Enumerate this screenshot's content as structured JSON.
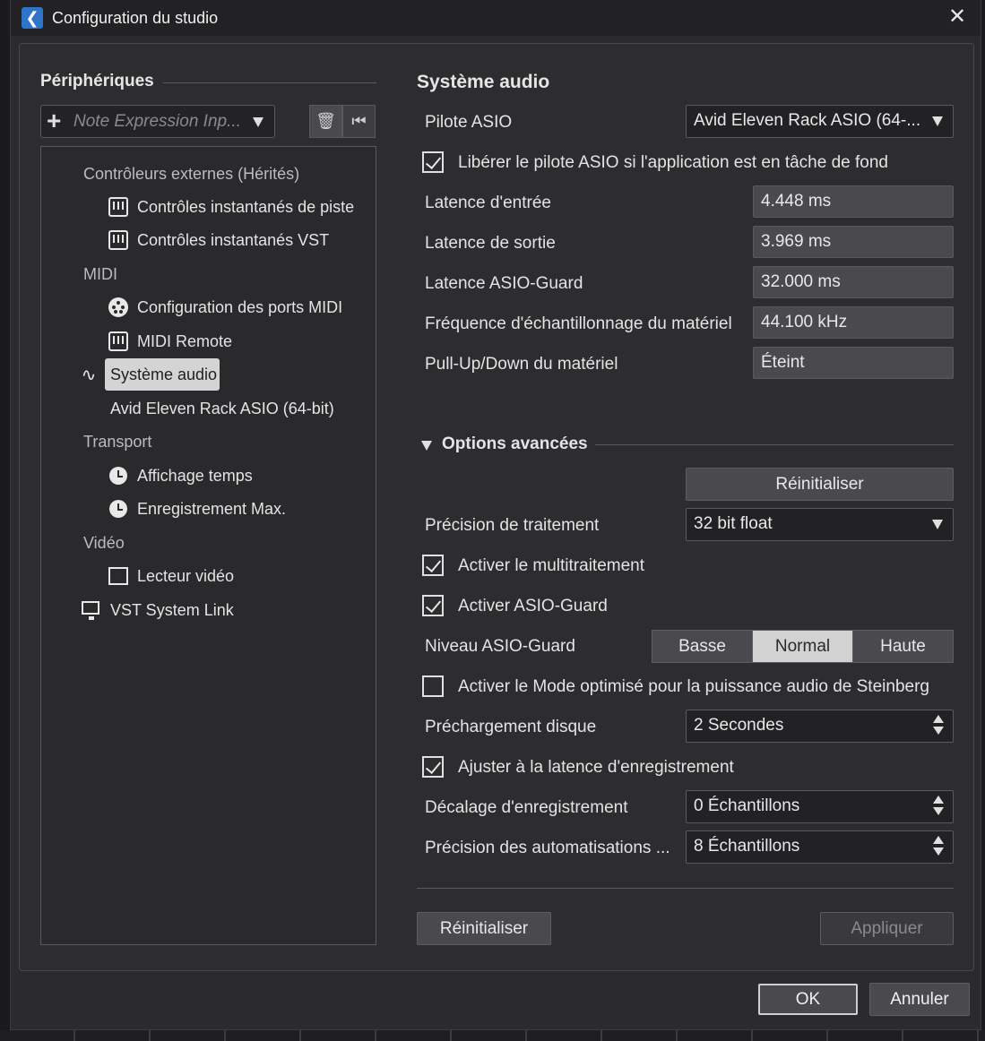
{
  "window": {
    "title": "Configuration du studio",
    "ok_label": "OK",
    "cancel_label": "Annuler"
  },
  "devices": {
    "section_title": "Périphériques",
    "add_dropdown_text": "Note Expression Inp...",
    "tree": {
      "cat_external": "Contrôleurs externes (Hérités)",
      "track_quick_controls": "Contrôles instantanés de piste",
      "vst_quick_controls": "Contrôles instantanés VST",
      "cat_midi": "MIDI",
      "midi_port_setup": "Configuration des ports MIDI",
      "midi_remote": "MIDI Remote",
      "audio_system": "Système audio",
      "asio_driver_item": "Avid Eleven Rack ASIO (64-bit)",
      "cat_transport": "Transport",
      "time_display": "Affichage temps",
      "record_time_max": "Enregistrement Max.",
      "cat_video": "Vidéo",
      "video_player": "Lecteur vidéo",
      "vst_system_link": "VST System Link"
    }
  },
  "audio_system": {
    "title": "Système audio",
    "asio_driver_label": "Pilote ASIO",
    "asio_driver_value": "Avid Eleven Rack ASIO (64-...",
    "release_driver_label": "Libérer le pilote ASIO si l'application est en tâche de fond",
    "release_driver_checked": true,
    "input_latency_label": "Latence d'entrée",
    "input_latency_value": "4.448 ms",
    "output_latency_label": "Latence de sortie",
    "output_latency_value": "3.969 ms",
    "asio_guard_latency_label": "Latence ASIO-Guard",
    "asio_guard_latency_value": "32.000 ms",
    "hw_sample_rate_label": "Fréquence d'échantillonnage du matériel",
    "hw_sample_rate_value": "44.100 kHz",
    "hw_pullupdown_label": "Pull-Up/Down du matériel",
    "hw_pullupdown_value": "Éteint"
  },
  "advanced": {
    "title": "Options avancées",
    "reset_label": "Réinitialiser",
    "processing_precision_label": "Précision de traitement",
    "processing_precision_value": "32 bit float",
    "multiprocessing_label": "Activer le multitraitement",
    "multiprocessing_checked": true,
    "asio_guard_label": "Activer ASIO-Guard",
    "asio_guard_checked": true,
    "asio_guard_level_label": "Niveau ASIO-Guard",
    "asio_guard_levels": [
      "Basse",
      "Normal",
      "Haute"
    ],
    "asio_guard_level_selected": "Normal",
    "steinberg_power_label": "Activer le Mode optimisé pour la puissance audio de Steinberg",
    "steinberg_power_checked": false,
    "disk_preload_label": "Préchargement disque",
    "disk_preload_value": "2 Secondes",
    "adjust_record_latency_label": "Ajuster à la latence d'enregistrement",
    "adjust_record_latency_checked": true,
    "record_shift_label": "Décalage d'enregistrement",
    "record_shift_value": "0 Échantillons",
    "automation_precision_label": "Précision des automatisations ...",
    "automation_precision_value": "8 Échantillons"
  },
  "footer": {
    "reset_label": "Réinitialiser",
    "apply_label": "Appliquer"
  }
}
